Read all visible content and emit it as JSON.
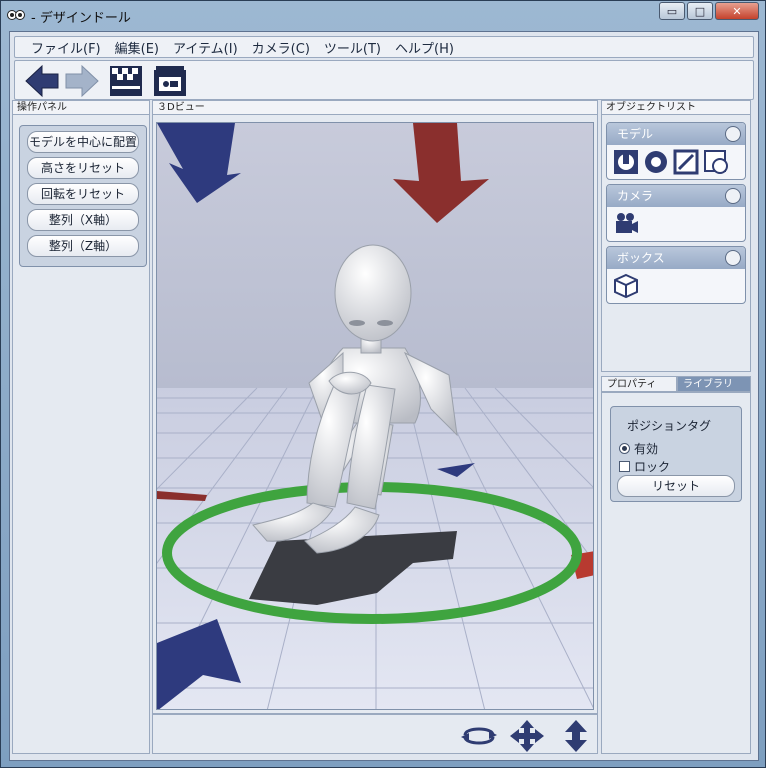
{
  "window": {
    "title": "- デザインドール",
    "buttons": {
      "minimize": "▭",
      "maximize": "□",
      "close": "✕"
    }
  },
  "menu": [
    "ファイル(F)",
    "編集(E)",
    "アイテム(I)",
    "カメラ(C)",
    "ツール(T)",
    "ヘルプ(H)"
  ],
  "toolbar": {
    "icons": [
      "undo-arrow-icon",
      "redo-arrow-icon",
      "clapperboard-icon",
      "camera-clapper-icon"
    ]
  },
  "operation_panel": {
    "header": "操作パネル",
    "buttons": [
      "モデルを中心に配置",
      "高さをリセット",
      "回転をリセット",
      "整列（X軸）",
      "整列（Z軸）"
    ]
  },
  "view3d": {
    "header": "３Dビュー"
  },
  "object_list": {
    "header": "オブジェクトリスト",
    "cards": [
      {
        "title": "モデル",
        "icons": [
          "pose-figure-icon",
          "lifebuoy-icon",
          "export-icon",
          "timer-icon"
        ]
      },
      {
        "title": "カメラ",
        "icons": [
          "movie-camera-icon"
        ]
      },
      {
        "title": "ボックス",
        "icons": [
          "cube-icon"
        ]
      }
    ]
  },
  "tabs": [
    "プロパティ",
    "ライブラリ"
  ],
  "properties": {
    "title": "ポジションタグ",
    "radio_label": "有効",
    "check_label": "ロック",
    "reset_label": "リセット"
  },
  "colors": {
    "accent_blue": "#2e3a7e",
    "accent_red": "#8a2f2d",
    "ring_green": "#3fa43f",
    "floor": "#dfe3f0",
    "sky": "#c8cbdb"
  }
}
